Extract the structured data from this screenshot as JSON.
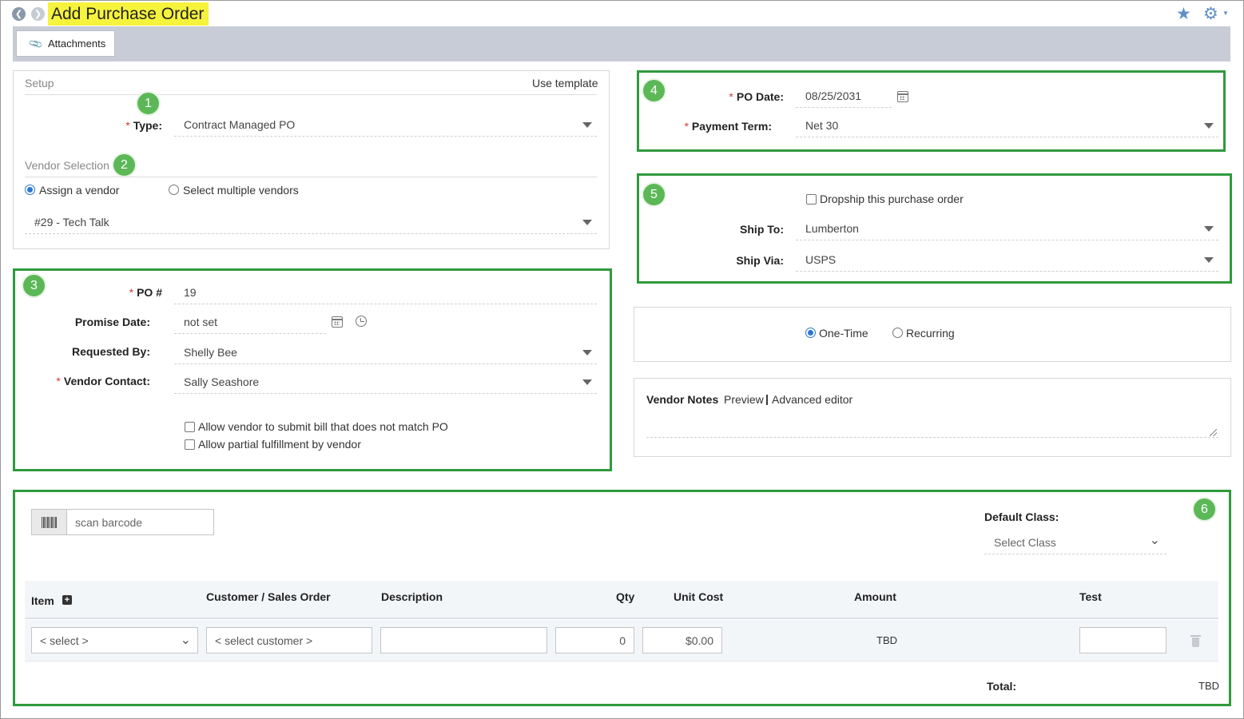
{
  "header": {
    "title": "Add Purchase Order",
    "tab_attachments": "Attachments"
  },
  "setup": {
    "title": "Setup",
    "use_template": "Use template",
    "type_label": "Type:",
    "type_value": "Contract Managed PO",
    "vendor_selection_title": "Vendor Selection",
    "assign_vendor": "Assign a vendor",
    "select_multiple": "Select multiple vendors",
    "vendor_value": "#29 - Tech Talk"
  },
  "po": {
    "po_number_label": "PO #",
    "po_number_value": "19",
    "promise_date_label": "Promise Date:",
    "promise_date_value": "not set",
    "requested_by_label": "Requested By:",
    "requested_by_value": "Shelly Bee",
    "vendor_contact_label": "Vendor Contact:",
    "vendor_contact_value": "Sally Seashore",
    "allow_bill_mismatch": "Allow vendor to submit bill that does not match PO",
    "allow_partial": "Allow partial fulfillment by vendor"
  },
  "dates": {
    "po_date_label": "PO Date:",
    "po_date_value": "08/25/2031",
    "payment_term_label": "Payment Term:",
    "payment_term_value": "Net 30"
  },
  "shipping": {
    "dropship_label": "Dropship this purchase order",
    "ship_to_label": "Ship To:",
    "ship_to_value": "Lumberton",
    "ship_via_label": "Ship Via:",
    "ship_via_value": "USPS"
  },
  "frequency": {
    "one_time": "One-Time",
    "recurring": "Recurring"
  },
  "vendor_notes": {
    "title": "Vendor Notes",
    "preview": "Preview",
    "separator": "|",
    "advanced_editor": "Advanced editor"
  },
  "items": {
    "scan_placeholder": "scan barcode",
    "default_class_label": "Default Class:",
    "default_class_value": "Select Class",
    "columns": [
      "Item",
      "Customer / Sales Order",
      "Description",
      "Qty",
      "Unit Cost",
      "Amount",
      "Test"
    ],
    "row": {
      "item": "< select >",
      "customer": "< select customer >",
      "qty": "0",
      "unit_cost": "$0.00",
      "amount": "TBD"
    },
    "total_label": "Total:",
    "total_value": "TBD"
  },
  "badges": [
    "1",
    "2",
    "3",
    "4",
    "5",
    "6"
  ],
  "colors": {
    "accent": "#3c7cc4",
    "highlight_box": "#2f9a3c",
    "badge": "#5cb857",
    "title_highlight": "#f6f33c",
    "toolbar": "#c7ccd6"
  }
}
